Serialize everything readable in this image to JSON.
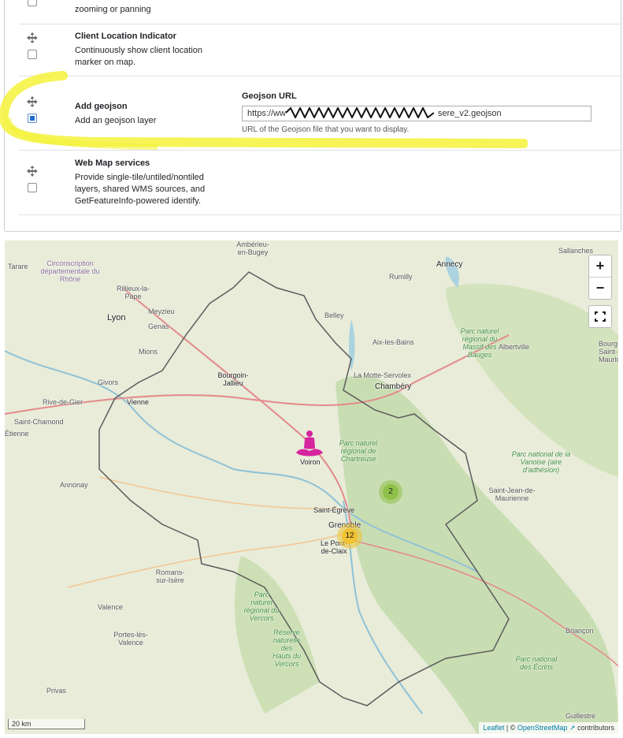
{
  "settings": {
    "rows": [
      {
        "title": "",
        "desc": "Disable direct user interaction like zooming or panning",
        "checked": false
      },
      {
        "title": "Client Location Indicator",
        "desc": "Continuously show client location marker on map.",
        "checked": false
      },
      {
        "title": "Add geojson",
        "desc": "Add an geojson layer",
        "checked": true
      },
      {
        "title": "Web Map services",
        "desc": "Provide single-tile/untiled/nontiled layers, shared WMS sources, and GetFeatureInfo-powered identify.",
        "checked": false
      }
    ],
    "geojson": {
      "label": "Geojson URL",
      "value_prefix": "https://ww",
      "value_suffix": "sere_v2.geojson",
      "help": "URL of the Geojson file that you want to display."
    }
  },
  "map": {
    "zoom_in": "+",
    "zoom_out": "−",
    "fullscreen_icon": "fullscreen-icon",
    "scale": "20 km",
    "attribution": {
      "leaflet": "Leaflet",
      "sep": " | © ",
      "osm": "OpenStreetMap",
      "rest": " contributors"
    },
    "clusters": [
      {
        "label": "2",
        "color": "#8fc04a"
      },
      {
        "label": "12",
        "color": "#f1c232"
      }
    ],
    "marker": {
      "icon": "meditation-person-icon",
      "color": "#d6249f"
    },
    "places": {
      "p1": "Tarare",
      "p2": "Circonscription départementale du Rhône",
      "p3": "Rillieux-la-Pape",
      "p4": "Meyzieu",
      "p5": "Lyon",
      "p6": "Genas",
      "p7": "Mions",
      "p8": "Bourgoin-Jallieu",
      "p9": "Givors",
      "p10": "Vienne",
      "p11": "Rive-de-Gier",
      "p12": "Saint-Chamond",
      "p13": "Étienne",
      "p14": "Annonay",
      "p15": "Romans-sur-Isère",
      "p16": "Valence",
      "p17": "Portes-lès-Valence",
      "p18": "Privas",
      "p19": "Ambérieu-en-Bugey",
      "p20": "Belley",
      "p21": "Rumilly",
      "p22": "Annecy",
      "p23": "Sallanches",
      "p24": "Aix-les-Bains",
      "p25": "Albertville",
      "p26": "La Motte-Servolex",
      "p27": "Chambéry",
      "p28": "Parc naturel régional du Massif des Bauges",
      "p29": "Parc naturel régional de Chartreuse",
      "p30": "Voiron",
      "p31": "Saint-Égrève",
      "p32": "Grenoble",
      "p33": "Le Pont-de-Claix",
      "p34": "Parc naturel régional du Vercors",
      "p35": "Réserve naturelle des Hauts du Vercors",
      "p36": "Saint-Jean-de-Maurienne",
      "p37": "Parc national de la Vanoise (aire d'adhésion)",
      "p38": "Briançon",
      "p39": "Parc national des Écrins",
      "p40": "Guillestre",
      "p41": "Bourg-Saint-Maurice"
    }
  }
}
